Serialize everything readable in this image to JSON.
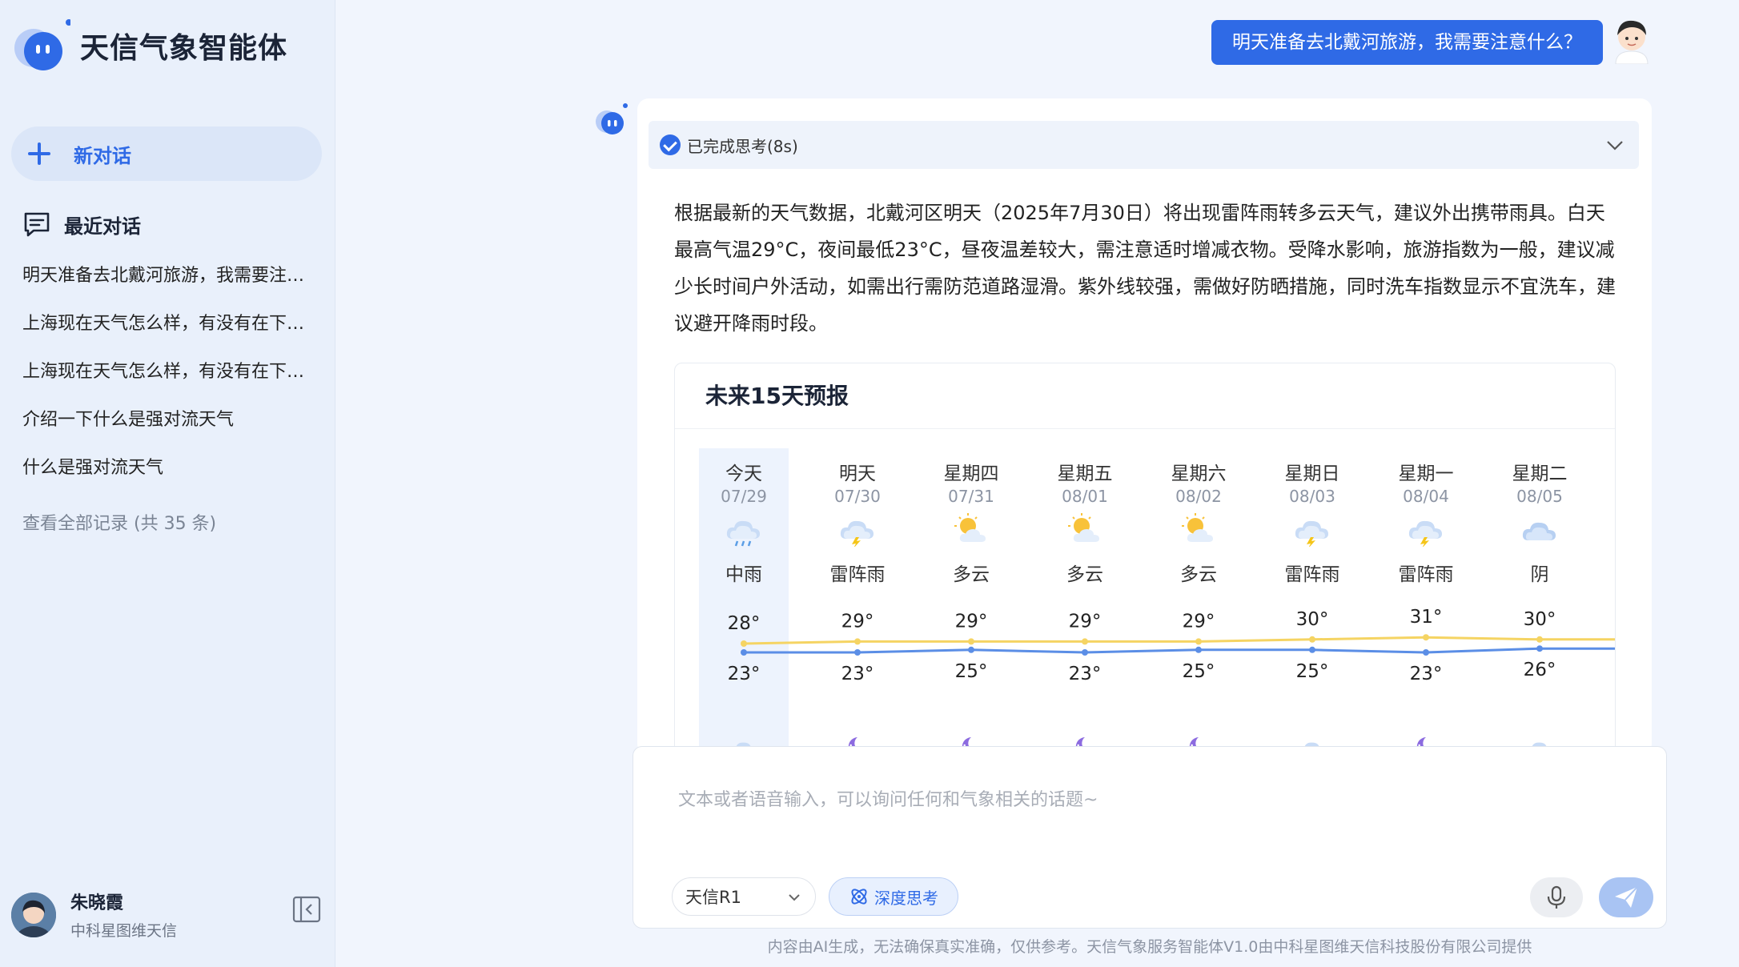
{
  "app": {
    "name": "天信气象智能体"
  },
  "sidebar": {
    "new_chat_label": "新对话",
    "recent_label": "最近对话",
    "history": [
      "明天准备去北戴河旅游，我需要注意什么？",
      "上海现在天气怎么样，有没有在下雨？",
      "上海现在天气怎么样，有没有在下雨？",
      "介绍一下什么是强对流天气",
      "什么是强对流天气"
    ],
    "view_all_label": "查看全部记录 (共 35 条)",
    "user": {
      "name": "朱晓霞",
      "org": "中科星图维天信"
    }
  },
  "conversation": {
    "user_message": "明天准备去北戴河旅游，我需要注意什么？",
    "thinking_status": "已完成思考(8s)",
    "answer": "根据最新的天气数据，北戴河区明天（2025年7月30日）将出现雷阵雨转多云天气，建议外出携带雨具。白天最高气温29°C，夜间最低23°C，昼夜温差较大，需注意适时增减衣物。受降水影响，旅游指数为一般，建议减少长时间户外活动，如需出行需防范道路湿滑。紫外线较强，需做好防晒措施，同时洗车指数显示不宜洗车，建议避开降雨时段。"
  },
  "forecast": {
    "title": "未来15天预报",
    "days": [
      {
        "name": "今天",
        "date": "07/29",
        "desc": "中雨",
        "icon": "rain-icon",
        "high": "28°",
        "low": "23°",
        "night_icon": "cloud-icon"
      },
      {
        "name": "明天",
        "date": "07/30",
        "desc": "雷阵雨",
        "icon": "thunderstorm-icon",
        "high": "29°",
        "low": "23°",
        "night_icon": "moon-cloud-icon"
      },
      {
        "name": "星期四",
        "date": "07/31",
        "desc": "多云",
        "icon": "partly-cloudy-icon",
        "high": "29°",
        "low": "25°",
        "night_icon": "moon-cloud-icon"
      },
      {
        "name": "星期五",
        "date": "08/01",
        "desc": "多云",
        "icon": "partly-cloudy-icon",
        "high": "29°",
        "low": "23°",
        "night_icon": "moon-cloud-icon"
      },
      {
        "name": "星期六",
        "date": "08/02",
        "desc": "多云",
        "icon": "partly-cloudy-icon",
        "high": "29°",
        "low": "25°",
        "night_icon": "moon-cloud-icon"
      },
      {
        "name": "星期日",
        "date": "08/03",
        "desc": "雷阵雨",
        "icon": "thunderstorm-icon",
        "high": "30°",
        "low": "25°",
        "night_icon": "cloud-icon"
      },
      {
        "name": "星期一",
        "date": "08/04",
        "desc": "雷阵雨",
        "icon": "thunderstorm-icon",
        "high": "31°",
        "low": "23°",
        "night_icon": "moon-cloud-icon"
      },
      {
        "name": "星期二",
        "date": "08/05",
        "desc": "阴",
        "icon": "overcast-icon",
        "high": "30°",
        "low": "26°",
        "night_icon": "cloud-icon"
      }
    ],
    "high_values": [
      28,
      29,
      29,
      29,
      29,
      30,
      31,
      30
    ],
    "low_values": [
      23,
      23,
      25,
      23,
      25,
      25,
      23,
      26
    ],
    "high_color": "#f5d463",
    "low_color": "#5b8ee6"
  },
  "input": {
    "placeholder": "文本或者语音输入，可以询问任何和气象相关的话题~",
    "model": "天信R1",
    "deep_think_label": "深度思考"
  },
  "footer": {
    "disclaimer": "内容由AI生成，无法确保真实准确，仅供参考。天信气象服务智能体V1.0由中科星图维天信科技股份有限公司提供"
  },
  "colors": {
    "accent": "#2f6ae6",
    "sidebar_bg": "#e9f0fb",
    "page_bg": "#f1f5fd"
  }
}
